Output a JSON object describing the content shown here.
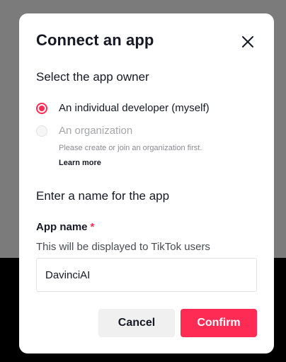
{
  "modal": {
    "title": "Connect an app",
    "owner_heading": "Select the app owner",
    "options": [
      {
        "label": "An individual developer (myself)",
        "selected": true,
        "disabled": false
      },
      {
        "label": "An organization",
        "selected": false,
        "disabled": true
      }
    ],
    "org_hint": "Please create or join an organization first.",
    "learn_more": "Learn more",
    "name_heading": "Enter a name for the app",
    "field_label": "App name",
    "required_marker": "*",
    "field_description": "This will be displayed to TikTok users",
    "field_value": "DavinciAI",
    "cancel_label": "Cancel",
    "confirm_label": "Confirm"
  },
  "colors": {
    "accent": "#fe2c55",
    "text": "#161823",
    "muted": "#a5a6a9",
    "backdrop": "#7b7b7b"
  },
  "icons": {
    "close": "close-icon"
  }
}
